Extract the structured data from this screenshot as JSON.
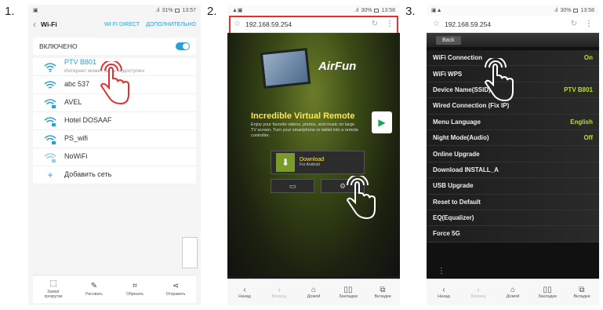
{
  "steps": [
    "1.",
    "2.",
    "3."
  ],
  "phone1": {
    "status_time": "13:57",
    "status_battery": "31%",
    "title": "Wi-Fi",
    "link_direct": "Wi-Fi Direct",
    "link_more": "ДОПОЛНИТЕЛЬНО",
    "enabled_label": "ВКЛЮЧЕНО",
    "networks": [
      {
        "name": "PTV B801",
        "sub": "Интернет может быть недоступен"
      },
      {
        "name": "abc 537",
        "sub": ""
      },
      {
        "name": "AVEL",
        "sub": ""
      },
      {
        "name": "Hotel DOSAAF",
        "sub": ""
      },
      {
        "name": "PS_wifi",
        "sub": ""
      },
      {
        "name": "NoWiFi",
        "sub": ""
      }
    ],
    "add_network": "Добавить сеть",
    "bottom": [
      "Захват прокрутки",
      "Рисовать",
      "Обрезать",
      "Отправить"
    ]
  },
  "phone2": {
    "status_time": "13:58",
    "status_battery": "30%",
    "url": "192.168.59.254",
    "brand": "AirFun",
    "headline": "Incredible Virtual Remote",
    "description": "Enjoy your favorite videos, photos, and music on large TV screen. Turn your smartphone or tablet into a remote controller.",
    "download_label": "Download",
    "download_sub": "For Android",
    "nav": [
      "Назад",
      "Вперед",
      "Домой",
      "Закладки",
      "Вкладки"
    ]
  },
  "phone3": {
    "status_time": "13:58",
    "status_battery": "30%",
    "url": "192.168.59.254",
    "back_label": "Back",
    "menu": [
      {
        "label": "WiFi Connection",
        "value": "On"
      },
      {
        "label": "WiFi WPS",
        "value": ""
      },
      {
        "label": "Device Name(SSID)",
        "value": "PTV B801"
      },
      {
        "label": "Wired Connection (Fix IP)",
        "value": ""
      },
      {
        "label": "Menu Language",
        "value": "English"
      },
      {
        "label": "Night Mode(Audio)",
        "value": "Off"
      },
      {
        "label": "Online Upgrade",
        "value": ""
      },
      {
        "label": "Download INSTALL_A",
        "value": ""
      },
      {
        "label": "USB Upgrade",
        "value": ""
      },
      {
        "label": "Reset to Default",
        "value": ""
      },
      {
        "label": "EQ(Equalizer)",
        "value": ""
      },
      {
        "label": "Force 5G",
        "value": ""
      }
    ],
    "nav": [
      "Назад",
      "Вперед",
      "Домой",
      "Закладки",
      "Вкладки"
    ]
  },
  "colors": {
    "accent_blue": "#2a9fd8",
    "highlight_red": "#e03030",
    "value_green": "#b8e020"
  }
}
